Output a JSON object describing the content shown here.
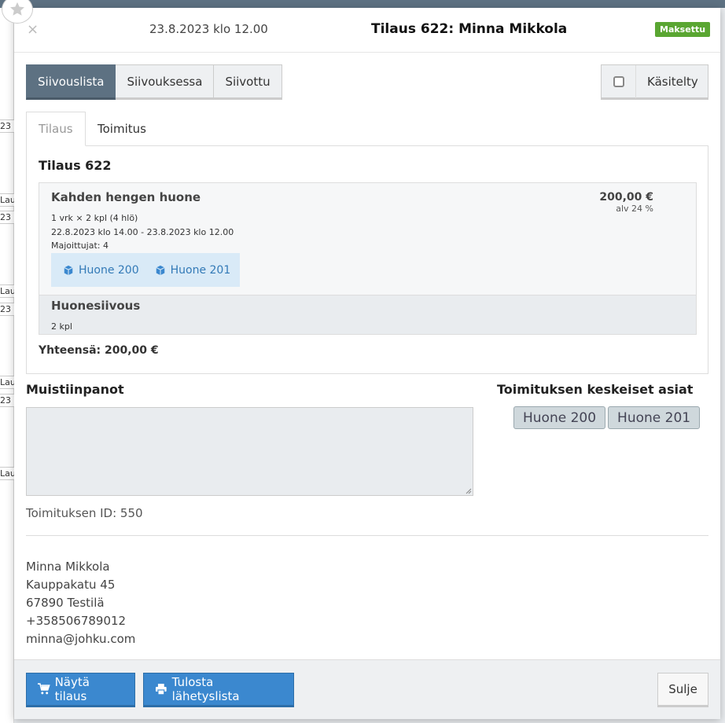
{
  "background": {
    "fragments": [
      "23 ",
      "Laus",
      "23 ",
      "Laus",
      "23 ",
      "Laus",
      "23 ",
      "Laus"
    ]
  },
  "header": {
    "close_icon": "×",
    "datetime": "23.8.2023 klo 12.00",
    "title": "Tilaus 622: Minna Mikkola",
    "status_badge": "Maksettu"
  },
  "status_tabs": [
    {
      "label": "Siivouslista",
      "active": true
    },
    {
      "label": "Siivouksessa",
      "active": false
    },
    {
      "label": "Siivottu",
      "active": false
    }
  ],
  "handled": {
    "label": "Käsitelty",
    "checked": false
  },
  "content_tabs": [
    {
      "label": "Tilaus",
      "active": true
    },
    {
      "label": "Toimitus",
      "active": false
    }
  ],
  "order": {
    "title": "Tilaus 622",
    "items": [
      {
        "name": "Kahden hengen huone",
        "price": "200,00 €",
        "vat": "alv 24 %",
        "quantity": "1 vrk × 2 kpl (4 hlö)",
        "period": "22.8.2023 klo 14.00 - 23.8.2023 klo 12.00",
        "guests": "Majoittujat: 4",
        "rooms": [
          "Huone 200",
          "Huone 201"
        ]
      },
      {
        "name": "Huonesiivous",
        "quantity": "2 kpl"
      }
    ],
    "total": "Yhteensä: 200,00 €"
  },
  "notes": {
    "title": "Muistiinpanot",
    "value": "",
    "delivery_id": "Toimituksen ID: 550"
  },
  "key_items": {
    "title": "Toimituksen keskeiset asiat",
    "tags": [
      "Huone 200",
      "Huone 201"
    ]
  },
  "contact": {
    "name": "Minna Mikkola",
    "street": "Kauppakatu 45",
    "city": "67890 Testilä",
    "phone": "+358506789012",
    "email": "minna@johku.com"
  },
  "footer": {
    "show_order": "Näytä tilaus",
    "print_list": "Tulosta lähetyslista",
    "close": "Sulje"
  },
  "colors": {
    "accent": "#5d7182",
    "primary": "#3b88cf",
    "paid": "#5aa632",
    "link": "#337ab7"
  }
}
